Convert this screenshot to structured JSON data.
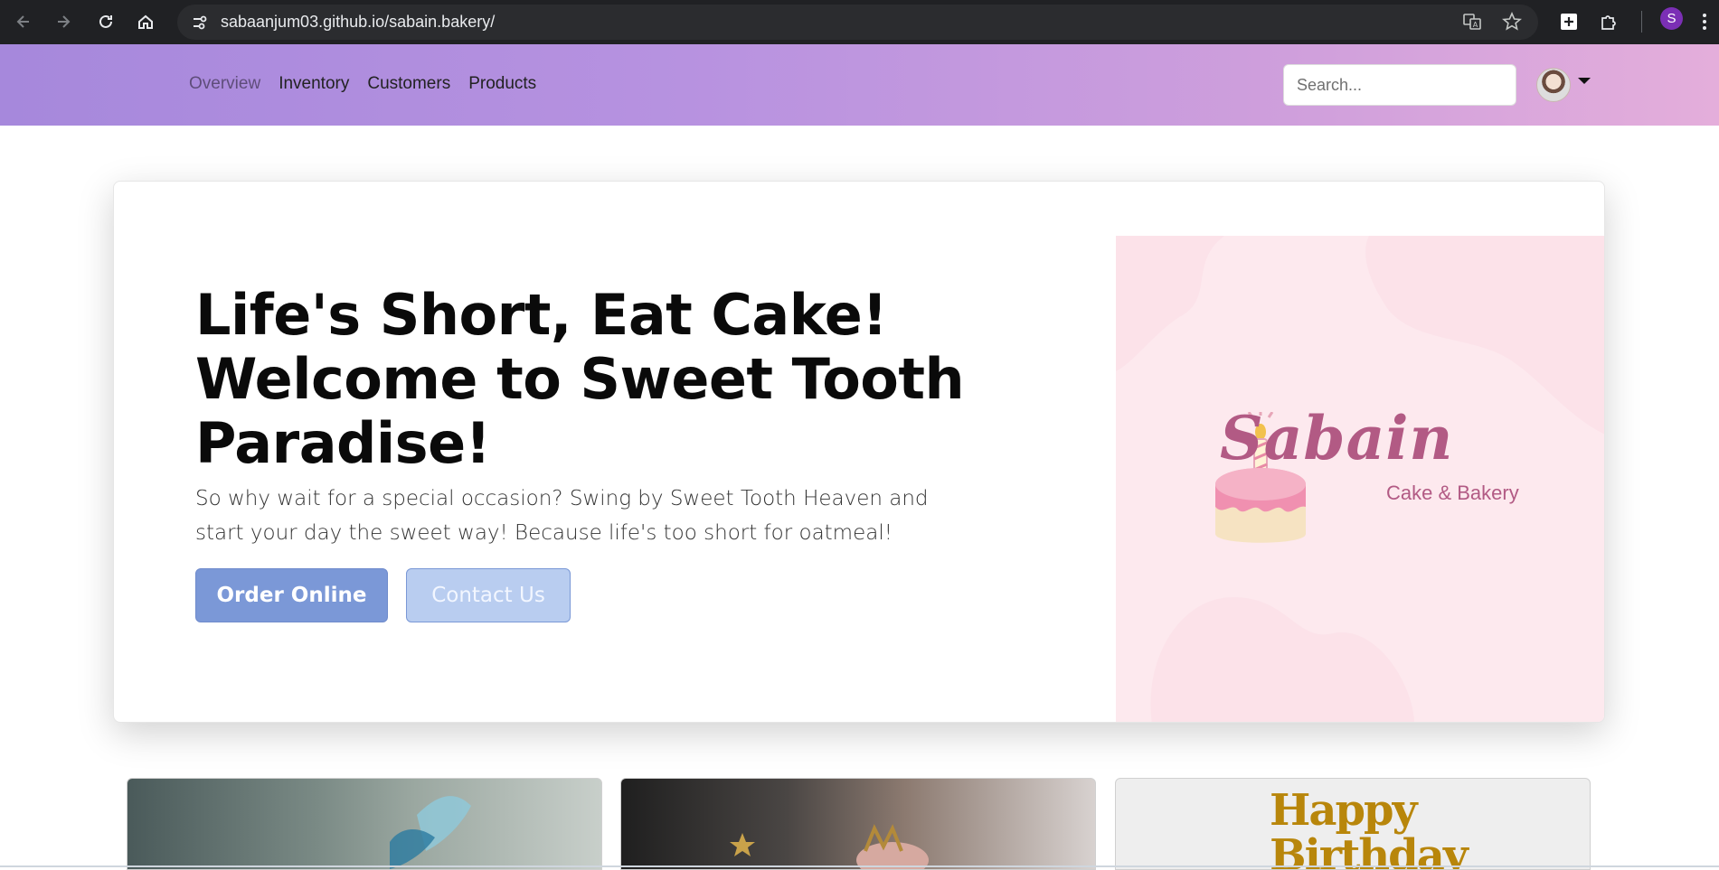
{
  "browser": {
    "url": "sabaanjum03.github.io/sabain.bakery/",
    "profile_initial": "S"
  },
  "nav": {
    "links": [
      "Overview",
      "Inventory",
      "Customers",
      "Products"
    ],
    "search_placeholder": "Search..."
  },
  "hero": {
    "title_line1": "Life's Short, Eat Cake!",
    "title_line2": "Welcome to Sweet Tooth",
    "title_line3": "Paradise!",
    "subtitle": "So why wait for a special occasion? Swing by Sweet Tooth Heaven and start your day the sweet way! Because life's too short for oatmeal!",
    "primary_button": "Order Online",
    "secondary_button": "Contact Us"
  },
  "logo": {
    "name": "Sabain",
    "tagline": "Cake & Bakery"
  },
  "thumbnails": {
    "third_topper_line1": "Happy",
    "third_topper_line2": "Birthday"
  },
  "colors": {
    "nav_gradient_start": "#a688dc",
    "nav_gradient_end": "#e4aedb",
    "primary_button": "#7b98d7",
    "secondary_button": "#b9cdf0",
    "logo_pink": "#b25a84",
    "logo_bg": "#fde9ee"
  }
}
